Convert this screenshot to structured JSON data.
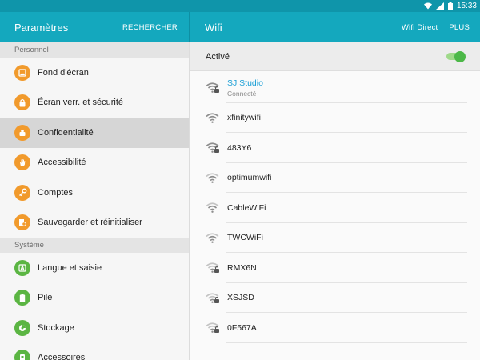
{
  "status_bar": {
    "time": "15:33"
  },
  "left_header": {
    "title": "Paramètres",
    "search_label": "RECHERCHER"
  },
  "right_header": {
    "title": "Wifi",
    "wifi_direct_label": "Wifi Direct",
    "more_label": "PLUS"
  },
  "sections": {
    "personnel": {
      "title": "Personnel",
      "items": [
        {
          "label": "Fond d'écran",
          "icon": "wallpaper-icon"
        },
        {
          "label": "Écran verr. et sécurité",
          "icon": "lock-icon"
        },
        {
          "label": "Confidentialité",
          "icon": "privacy-icon"
        },
        {
          "label": "Accessibilité",
          "icon": "hand-icon"
        },
        {
          "label": "Comptes",
          "icon": "key-icon"
        },
        {
          "label": "Sauvegarder et réinitialiser",
          "icon": "backup-icon"
        }
      ]
    },
    "systeme": {
      "title": "Système",
      "items": [
        {
          "label": "Langue et saisie",
          "icon": "language-icon"
        },
        {
          "label": "Pile",
          "icon": "battery-icon"
        },
        {
          "label": "Stockage",
          "icon": "storage-icon"
        },
        {
          "label": "Accessoires",
          "icon": "accessory-icon"
        }
      ]
    }
  },
  "wifi": {
    "active_label": "Activé",
    "toggle_on": true,
    "networks": [
      {
        "name": "SJ Studio",
        "status": "Connecté",
        "locked": true
      },
      {
        "name": "xfinitywifi",
        "status": "",
        "locked": false
      },
      {
        "name": "483Y6",
        "status": "",
        "locked": true
      },
      {
        "name": "optimumwifi",
        "status": "",
        "locked": false
      },
      {
        "name": "CableWiFi",
        "status": "",
        "locked": false
      },
      {
        "name": "TWCWiFi",
        "status": "",
        "locked": false
      },
      {
        "name": "RMX6N",
        "status": "",
        "locked": true
      },
      {
        "name": "XSJSD",
        "status": "",
        "locked": true
      },
      {
        "name": "0F567A",
        "status": "",
        "locked": true
      }
    ]
  },
  "colors": {
    "appbar": "#14a8be",
    "statusbar": "#0f95aa",
    "orange_icon": "#f19a2c",
    "green_icon": "#5bb543",
    "connected_text": "#1a9fd6",
    "toggle": "#4cb848"
  }
}
